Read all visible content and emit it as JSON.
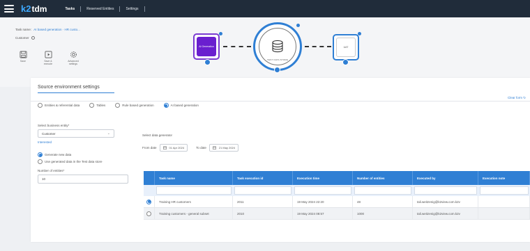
{
  "app": {
    "logo_prefix": "k2",
    "logo_text": "tdm",
    "tabs": [
      {
        "label": "Tasks"
      },
      {
        "label": "Reserved Entities"
      },
      {
        "label": "Settings"
      }
    ]
  },
  "task": {
    "name_label": "Task name:",
    "name_value": "AI based generation · HR custo...",
    "customer_label": "Customer"
  },
  "actions": [
    {
      "label": "Save",
      "icon": "save-icon"
    },
    {
      "label": "Save & execute",
      "icon": "save-execute-icon"
    },
    {
      "label": "Advanced settings",
      "icon": "gear-icon"
    }
  ],
  "flow": {
    "source_label": "AI Generation",
    "center_label": "TEST DATA STORE",
    "target_label": "UAT"
  },
  "section": {
    "title": "Source environment settings",
    "clear_form": "Clear form"
  },
  "source_options": [
    {
      "label": "Entities & referential data",
      "selected": false
    },
    {
      "label": "Tables",
      "selected": false
    },
    {
      "label": "Rule based generation",
      "selected": false
    },
    {
      "label": "AI based generation",
      "selected": true
    }
  ],
  "left": {
    "entity_label": "Select business entity*",
    "entity_value": "Customer",
    "link": "Interested",
    "generate_new": "Generate new data",
    "use_generated": "Use generated data in the Test data store",
    "entities_label": "Number of entities*",
    "entities_value": "10"
  },
  "right": {
    "generator_label": "Select data generator",
    "from_label": "From date",
    "from_value": "01 Apr 2024",
    "to_label": "To date",
    "to_value": "21 May 2024"
  },
  "table": {
    "headers": [
      "Task name",
      "Task execution id",
      "Execution time",
      "Number of entities",
      "Executed by",
      "Execution note"
    ],
    "rows": [
      {
        "selected": true,
        "cells": [
          "Training HR customers",
          "2011",
          "19 May 2024 22:20",
          "48",
          "tali.weitzenig@k2view.com.k2v",
          ""
        ]
      },
      {
        "selected": false,
        "cells": [
          "Training customers - general subset",
          "2010",
          "19 May 2024 08:57",
          "1000",
          "tali.weitzenig@k2view.com.k2v",
          ""
        ]
      }
    ]
  },
  "colors": {
    "topbar": "#202c3a",
    "accent": "#2f7fd4",
    "ai_node": "#6a1fcf"
  }
}
